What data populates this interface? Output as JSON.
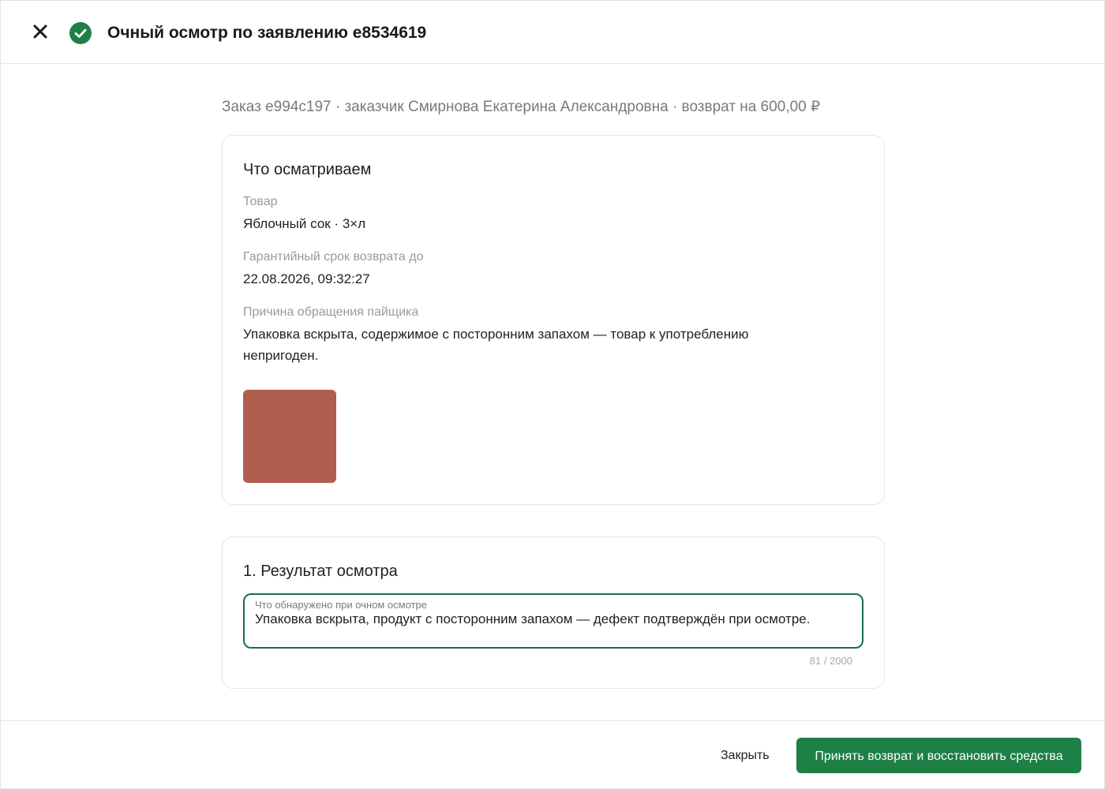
{
  "header": {
    "title": "Очный осмотр по заявлению e8534619",
    "close_icon": "close-icon",
    "status_icon": "check-circle-icon",
    "status_color": "#1e7f47"
  },
  "subtitle": "Заказ e994c197 · заказчик Смирнова Екатерина Александровна · возврат на 600,00 ₽",
  "details": {
    "title": "Что осматриваем",
    "product_label": "Товар",
    "product_value": "Яблочный сок · 3×л",
    "warranty_label": "Гарантийный срок возврата до",
    "warranty_value": "22.08.2026, 09:32:27",
    "reason_label": "Причина обращения пайщика",
    "reason_value": "Упаковка вскрыта, содержимое с посторонним запахом — товар к употреблению непригоден.",
    "photo_color": "#b05e4d"
  },
  "result": {
    "title": "1. Результат осмотра",
    "field_label": "Что обнаружено при очном осмотре",
    "field_value": "Упаковка вскрыта, продукт с посторонним запахом — дефект подтверждён при осмотре.",
    "counter": "81 / 2000",
    "border_color": "#1b6b53"
  },
  "footer": {
    "close_label": "Закрыть",
    "primary_label": "Принять возврат и восстановить средства",
    "primary_color": "#1e7f47"
  }
}
